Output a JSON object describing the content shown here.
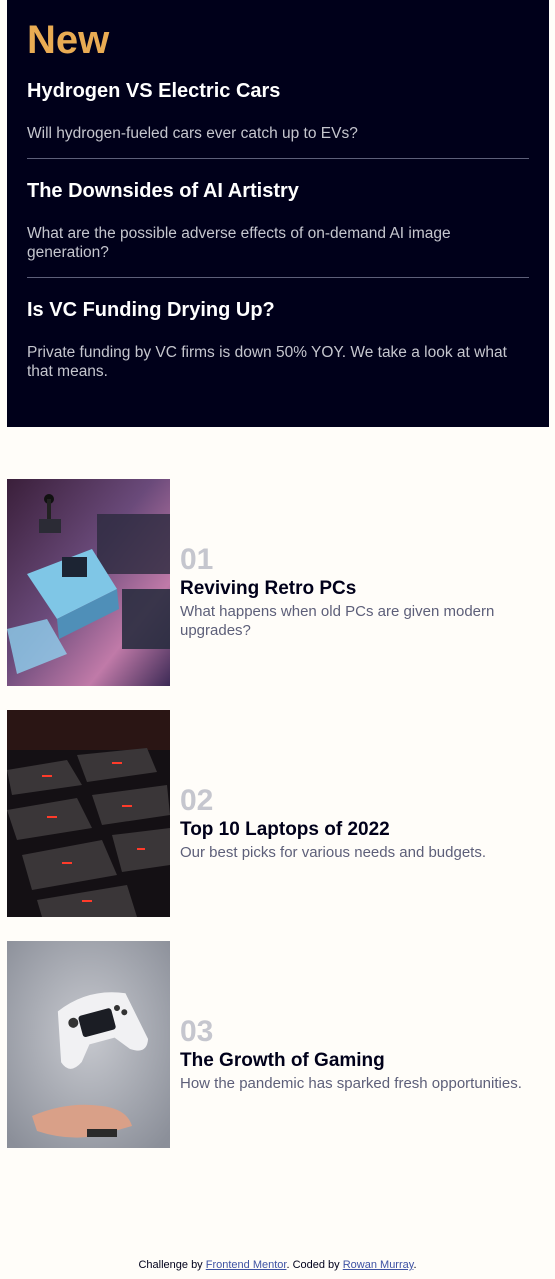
{
  "new_section": {
    "heading": "New",
    "items": [
      {
        "title": "Hydrogen VS Electric Cars",
        "desc": "Will hydrogen-fueled cars ever catch up to EVs?"
      },
      {
        "title": "The Downsides of AI Artistry",
        "desc": "What are the possible adverse effects of on-demand AI image generation?"
      },
      {
        "title": "Is VC Funding Drying Up?",
        "desc": "Private funding by VC firms is down 50% YOY. We take a look at what that means."
      }
    ]
  },
  "articles": [
    {
      "num": "01",
      "title": "Reviving Retro PCs",
      "desc": "What happens when old PCs are given modern upgrades?"
    },
    {
      "num": "02",
      "title": "Top 10 Laptops of 2022",
      "desc": "Our best picks for various needs and budgets."
    },
    {
      "num": "03",
      "title": "The Growth of Gaming",
      "desc": "How the pandemic has sparked fresh opportunities."
    }
  ],
  "attribution": {
    "prefix": "Challenge by ",
    "link1": "Frontend Mentor",
    "middle": ". Coded by ",
    "link2": "Rowan Murray",
    "suffix": "."
  },
  "colors": {
    "dark_bg": "#00001a",
    "accent_orange": "#e9ab53",
    "page_bg": "#fffdf9",
    "muted_number": "#c5c6ce"
  }
}
